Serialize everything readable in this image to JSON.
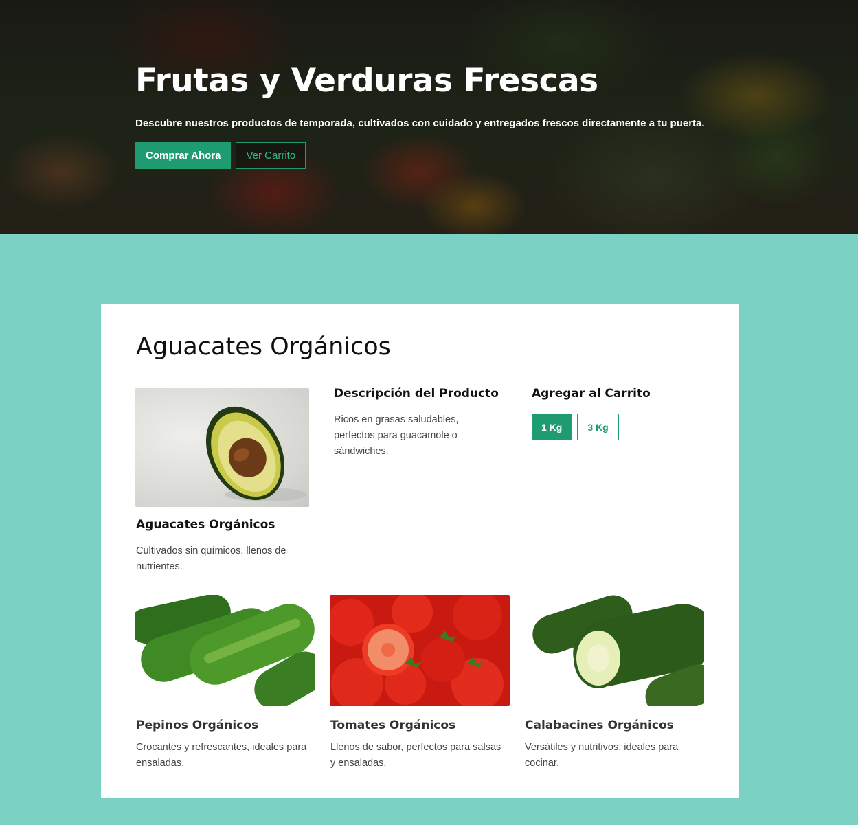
{
  "hero": {
    "title": "Frutas y Verduras Frescas",
    "subtitle": "Descubre nuestros productos de temporada, cultivados con cuidado y entregados frescos directamente a tu puerta.",
    "buy_label": "Comprar Ahora",
    "cart_label": "Ver Carrito"
  },
  "product": {
    "title": "Aguacates Orgánicos",
    "name": "Aguacates Orgánicos",
    "tagline": "Cultivados sin químicos, llenos de nutrientes.",
    "description_heading": "Descripción del Producto",
    "description": "Ricos en grasas saludables, perfectos para guacamole o sándwiches.",
    "add_to_cart_heading": "Agregar al Carrito",
    "sizes": [
      "1 Kg",
      "3 Kg"
    ],
    "selected_size": "1 Kg"
  },
  "related": [
    {
      "name": "Pepinos Orgánicos",
      "description": "Crocantes y refrescantes, ideales para ensaladas."
    },
    {
      "name": "Tomates Orgánicos",
      "description": "Llenos de sabor, perfectos para salsas y ensaladas."
    },
    {
      "name": "Calabacines Orgánicos",
      "description": "Versátiles y nutritivos, ideales para cocinar."
    }
  ],
  "colors": {
    "accent": "#1f9b72",
    "page_background": "#7bd1c3"
  }
}
